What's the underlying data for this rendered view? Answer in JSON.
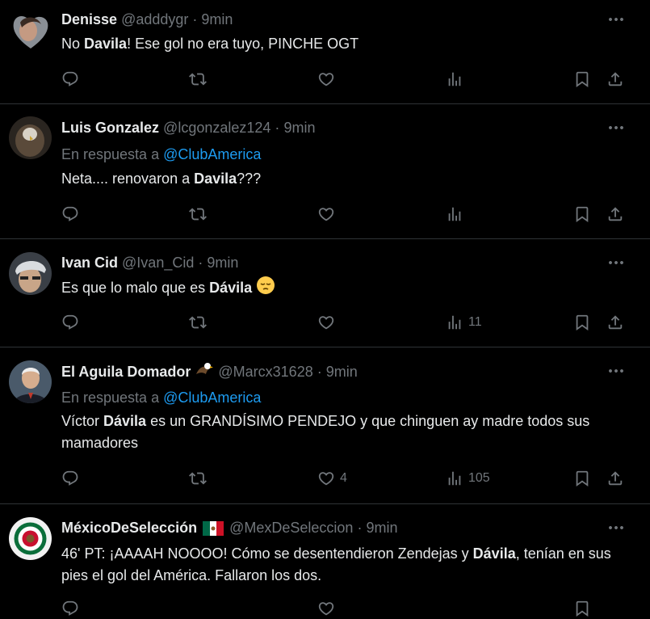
{
  "tweets": [
    {
      "name": "Denisse",
      "handle": "@adddygr",
      "dot": "·",
      "time": "9min",
      "text_parts": [
        "No ",
        "Davila",
        "! Ese gol no era tuyo, PINCHE OGT"
      ],
      "replies": "",
      "retweets": "",
      "likes": "",
      "views": ""
    },
    {
      "name": "Luis Gonzalez",
      "handle": "@lcgonzalez124",
      "dot": "·",
      "time": "9min",
      "reply_prefix": "En respuesta a ",
      "reply_target": "@ClubAmerica",
      "text_parts": [
        "Neta.... renovaron a ",
        "Davila",
        "???"
      ],
      "replies": "",
      "retweets": "",
      "likes": "",
      "views": ""
    },
    {
      "name": "Ivan Cid",
      "handle": "@Ivan_Cid",
      "dot": "·",
      "time": "9min",
      "text_parts": [
        "Es que lo malo que es ",
        "Dávila",
        " "
      ],
      "emoji": "pensive-face",
      "replies": "",
      "retweets": "",
      "likes": "",
      "views": "11"
    },
    {
      "name": "El Aguila Domador",
      "name_icon": "eagle-emoji",
      "handle": "@Marcx31628",
      "dot": "·",
      "time": "9min",
      "reply_prefix": "En respuesta a ",
      "reply_target": "@ClubAmerica",
      "text_parts": [
        "Víctor ",
        "Dávila",
        " es un GRANDÍSIMO PENDEJO y que chinguen ay madre todos sus mamadores"
      ],
      "replies": "",
      "retweets": "",
      "likes": "4",
      "views": "105"
    },
    {
      "name": "MéxicoDeSelección",
      "name_icon": "mexico-flag-emoji",
      "handle": "@MexDeSeleccion",
      "dot": "·",
      "time": "9min",
      "text_parts": [
        "46' PT: ¡AAAAH NOOOO! Cómo se desentendieron Zendejas y ",
        "Dávila",
        ", tenían en sus pies el gol del América. Fallaron los dos."
      ]
    }
  ],
  "colors": {
    "background": "#000000",
    "text": "#e7e9ea",
    "muted": "#71767b",
    "link": "#1d9bf0",
    "border": "#2f3336"
  }
}
